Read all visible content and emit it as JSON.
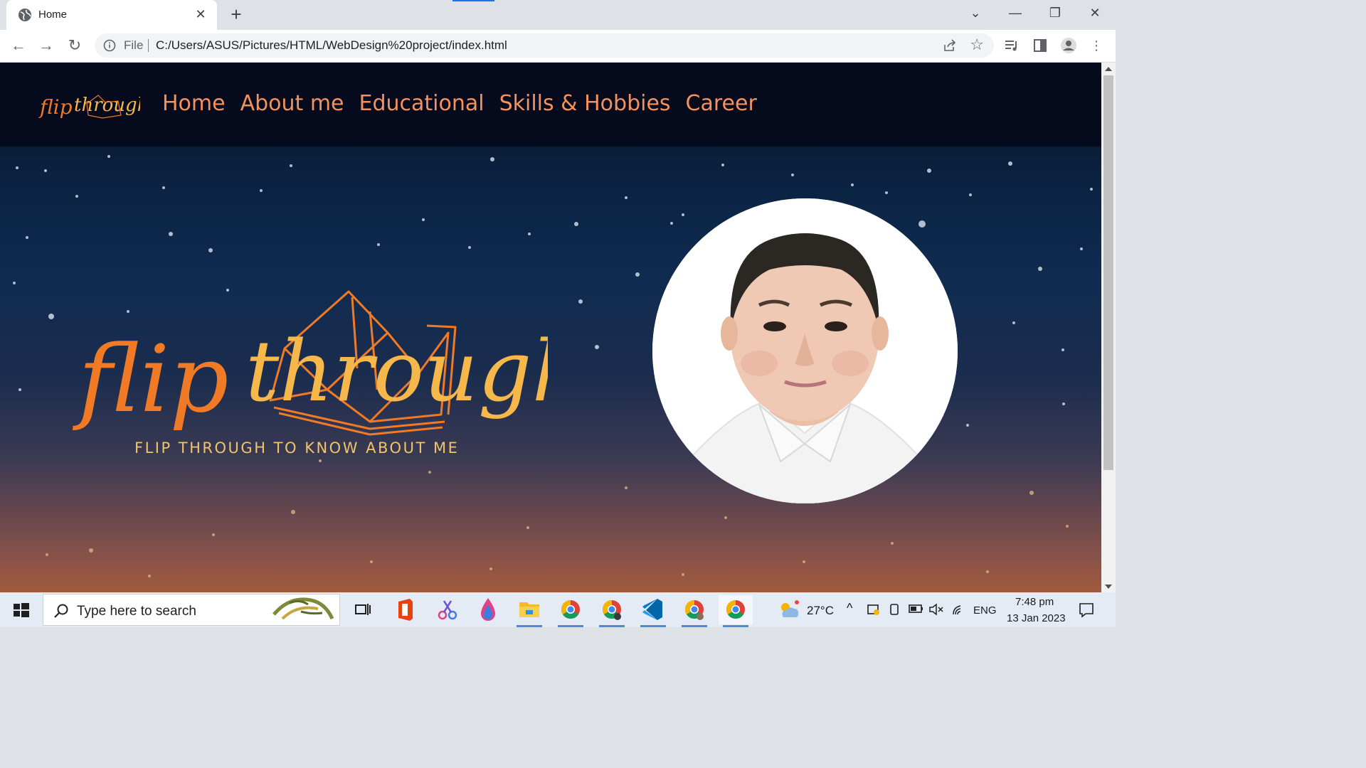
{
  "browser": {
    "tab_title": "Home",
    "address_scheme": "File",
    "address_url": "C:/Users/ASUS/Pictures/HTML/WebDesign%20project/index.html"
  },
  "site": {
    "logo_text": "flip through",
    "nav": [
      "Home",
      "About me",
      "Educational",
      "Skills & Hobbies",
      "Career"
    ],
    "hero_title": "flip through",
    "tagline": "FLIP THROUGH TO KNOW ABOUT ME"
  },
  "taskbar": {
    "search_placeholder": "Type here to search",
    "weather": "27°C",
    "language": "ENG",
    "time": "7:48 pm",
    "date": "13 Jan 2023"
  },
  "colors": {
    "nav_link": "#f5915a",
    "tagline": "#f0c46a",
    "logo_orange": "#f07a26",
    "logo_yellow": "#f6b84a"
  },
  "icons": [
    "globe-icon",
    "close-icon",
    "plus-icon",
    "back-icon",
    "forward-icon",
    "reload-icon",
    "info-icon",
    "share-icon",
    "star-icon",
    "media-icon",
    "sidepanel-icon",
    "profile-icon",
    "menu-icon",
    "windows-icon",
    "search-icon",
    "taskview-icon",
    "office-icon",
    "snip-icon",
    "paint-icon",
    "folder-icon",
    "chrome-icon",
    "vscode-icon",
    "weather-icon",
    "notifications-icon"
  ]
}
